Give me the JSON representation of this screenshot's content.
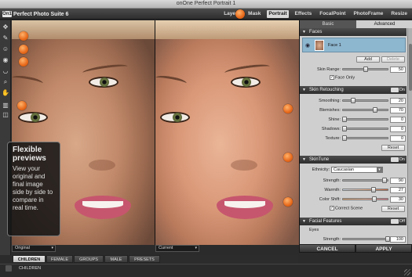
{
  "window": {
    "title": "onOne Perfect Portrait 1"
  },
  "app": {
    "logo_mark": "On1",
    "brand": "Perfect Photo Suite 6"
  },
  "nav": [
    "Layers",
    "Mask",
    "Portrait",
    "Effects",
    "FocalPoint",
    "PhotoFrame",
    "Resize"
  ],
  "nav_active": "Portrait",
  "callout": {
    "title": "Flexible previews",
    "body": "View your original and final image side by side to compare in real time."
  },
  "panes": {
    "left_label": "Original",
    "right_label": "Current"
  },
  "bottom_tabs": [
    "CHILDREN",
    "FEMALE",
    "GROUPS",
    "MALE",
    "PRESETS"
  ],
  "bottom_tabs_active": "CHILDREN",
  "breadcrumb": "CHILDREN",
  "panel": {
    "tabs": [
      "Basic",
      "Advanced"
    ],
    "active_tab": "Advanced",
    "faces": {
      "title": "Faces",
      "face_label": "Face 1",
      "add_label": "Add",
      "delete_label": "Delete",
      "skin_range_label": "Skin Range:",
      "skin_range_value": "50",
      "face_only_label": "Face Only",
      "face_only_checked": true
    },
    "skin_retouching": {
      "title": "Skin Retouching",
      "toggle_label": "On",
      "sliders": [
        {
          "label": "Smoothing:",
          "value": "20"
        },
        {
          "label": "Blemishes:",
          "value": "70"
        },
        {
          "label": "Shine:",
          "value": "0"
        },
        {
          "label": "Shadows:",
          "value": "0"
        },
        {
          "label": "Texture:",
          "value": "0"
        }
      ],
      "reset_label": "Reset"
    },
    "skintune": {
      "title": "SkinTune",
      "toggle_label": "On",
      "ethnicity_label": "Ethnicity:",
      "ethnicity_value": "Caucasian",
      "sliders": [
        {
          "label": "Strength:",
          "value": "90"
        },
        {
          "label": "Warmth:",
          "value": "27"
        },
        {
          "label": "Color Shift:",
          "value": "30"
        }
      ],
      "correct_scene_label": "Correct Scene",
      "correct_scene_checked": true,
      "reset_label": "Reset"
    },
    "facial_features": {
      "title": "Facial Features",
      "toggle_label": "Off",
      "eyes_label": "Eyes",
      "strength_label": "Strength:",
      "strength_value": "100"
    }
  },
  "footer": {
    "cancel_label": "CANCEL",
    "apply_label": "APPLY"
  },
  "colors": {
    "marker": "#e7681a",
    "face_row": "#8db6cf",
    "lips": "#c6566d"
  }
}
